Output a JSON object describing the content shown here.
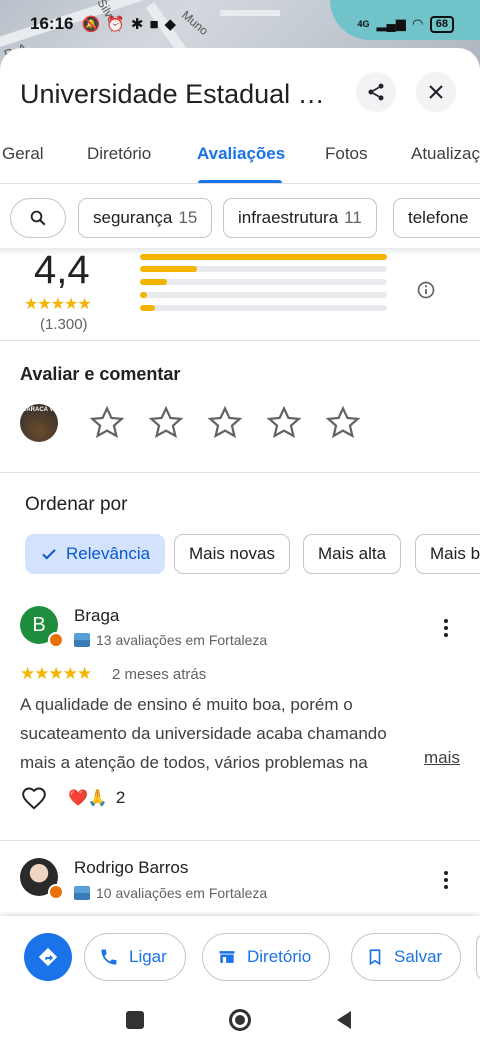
{
  "status_bar": {
    "time": "16:16",
    "network": "4G",
    "battery": "68"
  },
  "map": {
    "street_labels": [
      "R. A",
      "Silve",
      "Muno"
    ]
  },
  "header": {
    "title": "Universidade Estadual d..."
  },
  "tabs": [
    {
      "label": "Geral"
    },
    {
      "label": "Diretório"
    },
    {
      "label": "Avaliações",
      "active": true
    },
    {
      "label": "Fotos"
    },
    {
      "label": "Atualizaç"
    }
  ],
  "topic_chips": [
    {
      "label": "segurança",
      "count": "15"
    },
    {
      "label": "infraestrutura",
      "count": "11"
    },
    {
      "label": "telefone",
      "count": ""
    }
  ],
  "rating_summary": {
    "average": "4,4",
    "stars_glyphs": "★★★★★",
    "count": "(1.300)",
    "distribution": [
      {
        "stars": 5,
        "fraction": 1.0
      },
      {
        "stars": 4,
        "fraction": 0.23
      },
      {
        "stars": 3,
        "fraction": 0.11
      },
      {
        "stars": 2,
        "fraction": 0.03
      },
      {
        "stars": 1,
        "fraction": 0.06
      }
    ]
  },
  "rate_section": {
    "title": "Avaliar e comentar",
    "avatar_text": "CARACA VE"
  },
  "sort": {
    "title": "Ordenar por",
    "options": [
      {
        "label": "Relevância",
        "selected": true
      },
      {
        "label": "Mais novas"
      },
      {
        "label": "Mais alta"
      },
      {
        "label": "Mais b"
      }
    ]
  },
  "reviews": [
    {
      "initial": "B",
      "name": "Braga",
      "meta": "13 avaliações em Fortaleza",
      "stars": "★★★★★",
      "date": "2 meses atrás",
      "text": "A qualidade de ensino é muito boa, porém o sucateamento da universidade acaba chamando mais a atenção de todos, vários problemas na infraestr...",
      "more": "mais",
      "reactions": "❤️🙏",
      "reaction_count": "2"
    },
    {
      "name": "Rodrigo Barros",
      "meta": "10 avaliações em Fortaleza"
    }
  ],
  "actions": [
    {
      "label": "Ligar",
      "icon": "phone-icon"
    },
    {
      "label": "Diretório",
      "icon": "directory-icon"
    },
    {
      "label": "Salvar",
      "icon": "bookmark-icon"
    }
  ],
  "colors": {
    "accent": "#1a73e8",
    "star": "#f4b400",
    "selected_chip": "#d3e3fd"
  }
}
